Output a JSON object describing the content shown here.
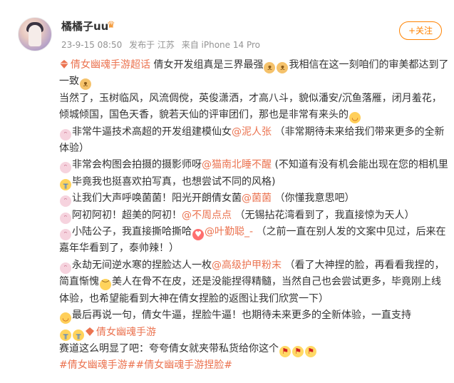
{
  "post": {
    "username": "橘橘子uu",
    "crown_icon": "crown-icon",
    "date": "23-9-15 08:50",
    "posted_from": "发布于 江苏",
    "device": "来自 iPhone 14 Pro",
    "follow_label": "+关注"
  },
  "content": {
    "p1_topic": "倩女幽魂手游超话",
    "p1_text": " 倩女开发组真是三界最强",
    "p1_text2": "我相信在这一刻咱们的审美都达到了一致",
    "p2_text": "当然了，玉树临风，风流倜傥，英俊潇洒，才高八斗，貌似潘安/沉鱼落雁，闭月羞花，倾城倾国，国色天香，貌若天仙的评审团们，那也是非常有来头的",
    "p3_pre": "非常牛逼技术高超的开发组建模仙女",
    "p3_mention": "@泥人张",
    "p3_post": " （非常期待未来给我们带来更多的全新体验）",
    "p4_pre": "非常会构图会拍摄的摄影师呀",
    "p4_mention": "@猫南北睡不醒",
    "p4_post": " (不知道有没有机会能出现在您的相机里",
    "p4_post2": "毕竟我也挺喜欢拍写真，也想尝试不同的风格)",
    "p5_pre": "让我们大声呼唤菌菌！阳光开朗倩女菌",
    "p5_mention": "@菌菌",
    "p5_post": " （你懂我意思吧）",
    "p6_pre": "阿初阿初！超美的阿初！",
    "p6_mention": "@不周点点",
    "p6_post": " （无锡拈花湾看到了，我直接惊为天人）",
    "p7_pre": "小陆公子，我直接撕哈撕哈",
    "p7_mention": "@叶勤聪_-",
    "p7_post": " （之前一直在别人发的文案中见过，后来在嘉年华看到了，泰帅辣！）",
    "p8_pre": "永劫无间逆水寒的捏脸达人一枚",
    "p8_mention": "@高级护甲粉末",
    "p8_post": " （看了大神捏的脸，再看看我捏的，简直惭愧",
    "p8_post2": "美人在骨不在皮，还是没能捏得精髓，当然自己也会尝试更多，毕竟刚上线体验，也希望能看到大神在倩女捏脸的返图让我们欣赏一下）",
    "p9_text": "最后再说一句，倩女牛逼，捏脸牛逼！也期待未来更多的全新体验，一直支持",
    "p9_topic": "倩女幽魂手游",
    "p10_text": "赛道这么明显了吧：夸夸倩女就夹带私货给你这个",
    "tags": "#倩女幽魂手游##倩女幽魂手游捏脸#"
  },
  "icons": {
    "diamond": "diamond-icon",
    "cat": "cat-emoji-icon",
    "bunny": "bunny-emoji-icon",
    "blush": "blush-emoji-icon",
    "heart": "heart-eyes-emoji-icon",
    "sad": "sad-emoji-icon",
    "cry": "cry-emoji-icon",
    "flag": "flag-emoji-icon"
  },
  "colors": {
    "link": "#eb7350",
    "follow": "#ff8200",
    "meta": "#939393"
  }
}
